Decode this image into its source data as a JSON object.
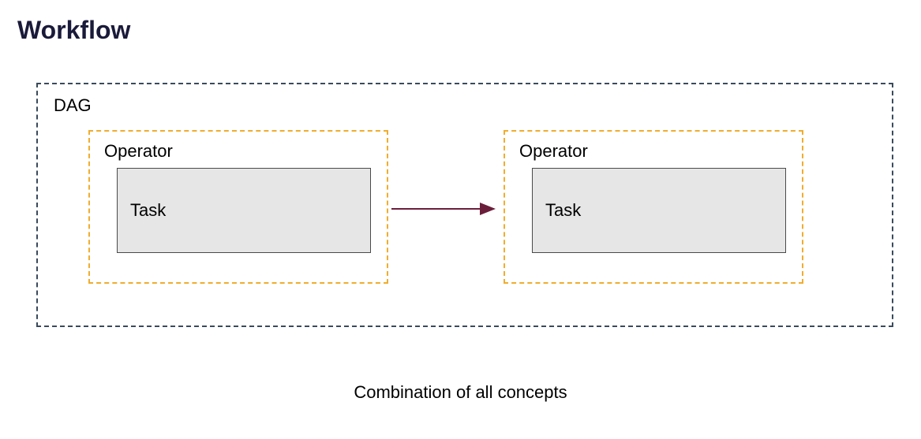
{
  "heading": "Workflow",
  "diagram": {
    "dag_label": "DAG",
    "operators": [
      {
        "label": "Operator",
        "task_label": "Task"
      },
      {
        "label": "Operator",
        "task_label": "Task"
      }
    ]
  },
  "caption": "Combination of all concepts",
  "colors": {
    "dag_border": "#3a4a5c",
    "operator_border": "#f0ad2e",
    "task_fill": "#e6e6e6",
    "task_border": "#4a4a4a",
    "arrow": "#6b1e3a",
    "heading": "#1a1a3a"
  }
}
